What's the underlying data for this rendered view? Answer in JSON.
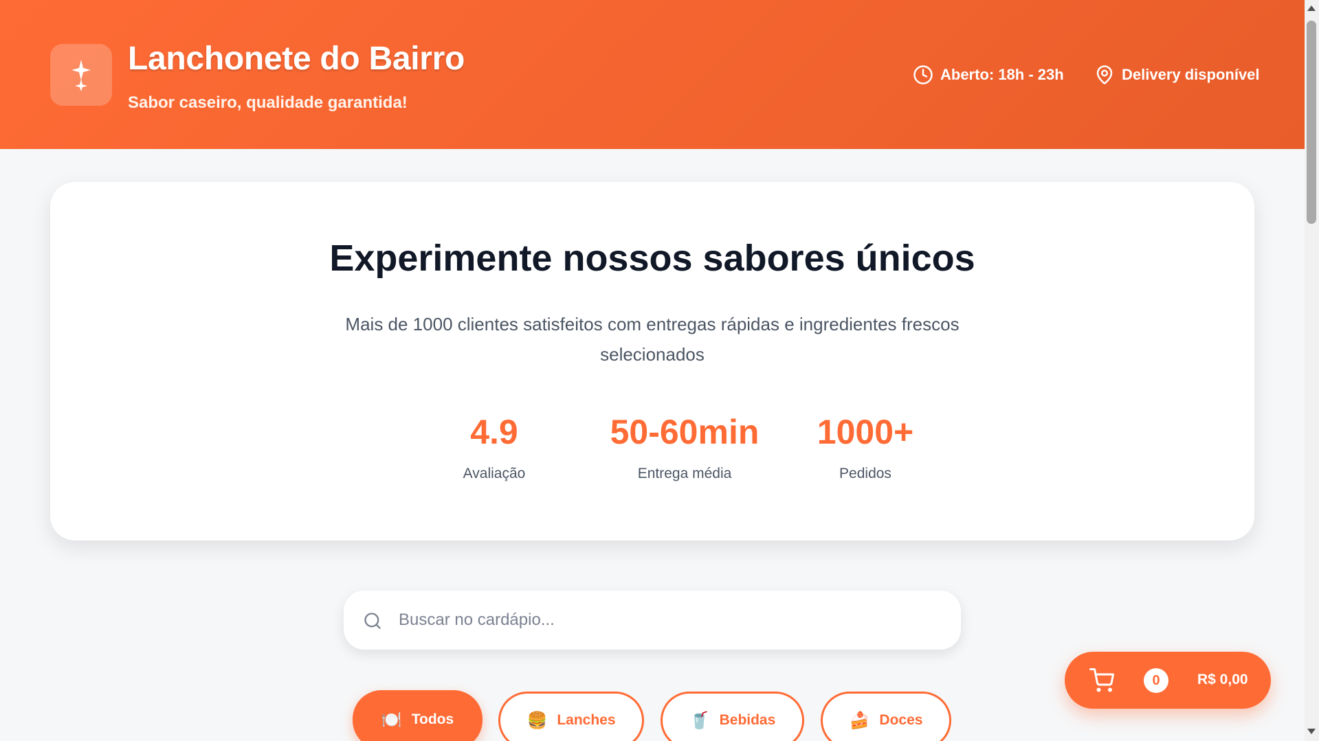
{
  "header": {
    "title": "Lanchonete do Bairro",
    "subtitle": "Sabor caseiro, qualidade garantida!",
    "logo_icon": "sparkles-icon",
    "hours": "Aberto: 18h - 23h",
    "hours_icon": "clock-icon",
    "delivery": "Delivery disponível",
    "delivery_icon": "map-pin-icon"
  },
  "hero": {
    "title": "Experimente nossos sabores únicos",
    "description": "Mais de 1000 clientes satisfeitos com entregas rápidas e ingredientes frescos selecionados",
    "stats": [
      {
        "value": "4.9",
        "label": "Avaliação"
      },
      {
        "value": "50-60min",
        "label": "Entrega média"
      },
      {
        "value": "1000+",
        "label": "Pedidos"
      }
    ]
  },
  "search": {
    "placeholder": "Buscar no cardápio...",
    "value": ""
  },
  "categories": [
    {
      "emoji": "🍽️",
      "label": "Todos",
      "active": true
    },
    {
      "emoji": "🍔",
      "label": "Lanches",
      "active": false
    },
    {
      "emoji": "🥤",
      "label": "Bebidas",
      "active": false
    },
    {
      "emoji": "🍰",
      "label": "Doces",
      "active": false
    }
  ],
  "cart": {
    "icon": "cart-icon",
    "count": "0",
    "total": "R$ 0,00"
  },
  "colors": {
    "accent": "#ff6b35",
    "text_dark": "#111827",
    "text_muted": "#4b5563",
    "background": "#f6f7f8"
  }
}
